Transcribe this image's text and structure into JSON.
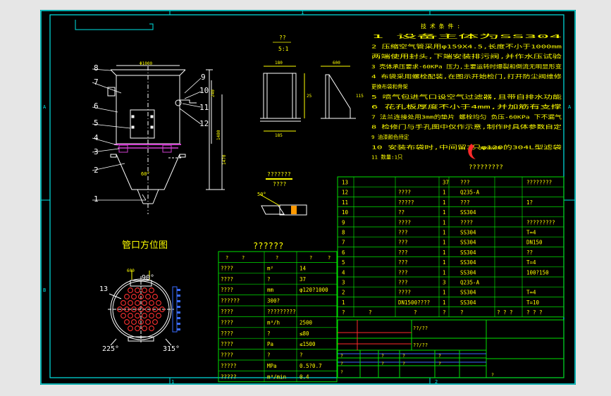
{
  "colors": {
    "frame": "#00e5e5",
    "table": "#00e000",
    "line": "#ffffff",
    "text": "#ffff00",
    "accent_red": "#ff2a2a",
    "accent_blue": "#3a6cff",
    "hatch": "#d040d0"
  },
  "zone_marks": {
    "top": "1",
    "bottom_left": "1",
    "bottom_right": "2",
    "left_a": "A",
    "left_b": "B",
    "right_a": "A"
  },
  "tech_req": {
    "title": "技 术 条 件 :",
    "items": [
      "1  设备主体为SS304",
      "2  压缩空气管采用φ159X4.5,长度不小于1000mm",
      "   两端使用封头,下端安装排污阀,并作水压试验",
      "3  壳体承压要求-60KPa  压力,主要运转时爆裂和倒流无明显形变",
      "4  布袋采用螺栓配装,在图示开始检门,打开防尘阀维修",
      "   更换布袋和骨架",
      "5  喷气包进气口设空气过滤器,且带自排水功能",
      "6  花孔板厚度不小于4mm,并加筋有支撑",
      "7  法兰连接处用3mm的垫片 螺栓均匀 负压-60KPa  下不漏气",
      "8  检修门与手孔图中仅作示意,制作时具体参数自定",
      "9  油漆颜色待定",
      "10 安装布袋时,中间留3只φ120的304L型滤袋",
      "11 数量:1只"
    ],
    "subtitle": "?????????"
  },
  "detail_a": {
    "title": "??",
    "scale": "5:1",
    "dims": [
      "180",
      "185",
      "25",
      "600",
      "115"
    ]
  },
  "detail_b": {
    "label": "???????",
    "sub": "????",
    "angle": "50°"
  },
  "main_view": {
    "callouts": [
      "1",
      "2",
      "3",
      "4",
      "5",
      "6",
      "7",
      "8",
      "9",
      "10",
      "11",
      "12"
    ],
    "dims": [
      "Φ1000",
      "60°",
      "240",
      "1480",
      "1470"
    ]
  },
  "orientation": {
    "title": "管口方位图",
    "label13": "13",
    "angle_left": "225°",
    "angle_right": "315°",
    "angle_top": "90°",
    "dim_top": "600"
  },
  "spec_table": {
    "title": "??????",
    "header": [
      "?",
      "?",
      "?",
      "?",
      "?"
    ],
    "rows": [
      [
        "????",
        "m²",
        "14"
      ],
      [
        "????",
        "?",
        "37"
      ],
      [
        "????",
        "mm",
        "φ120?1000"
      ],
      [
        "??????",
        "300?",
        ""
      ],
      [
        "????",
        "?????????",
        ""
      ],
      [
        "????",
        "m³/h",
        "2500"
      ],
      [
        "????",
        "?",
        "≤80"
      ],
      [
        "????",
        "Pa",
        "≤1500"
      ],
      [
        "????",
        "?",
        "?"
      ],
      [
        "?????",
        "MPa",
        "0.5?0.7"
      ],
      [
        "?????",
        "m³/min",
        "0.4"
      ]
    ]
  },
  "parts_list": {
    "rows": [
      {
        "no": "13",
        "name": "",
        "spec": "",
        "qty": "37",
        "mat": "???",
        "note": "????????"
      },
      {
        "no": "12",
        "name": "",
        "spec": "????",
        "qty": "1",
        "mat": "Q235-A",
        "note": ""
      },
      {
        "no": "11",
        "name": "",
        "spec": "?????",
        "qty": "1",
        "mat": "???",
        "note": "1?"
      },
      {
        "no": "10",
        "name": "",
        "spec": "??",
        "qty": "1",
        "mat": "SS304",
        "note": ""
      },
      {
        "no": "9",
        "name": "",
        "spec": "????",
        "qty": "1",
        "mat": "????",
        "note": "?????????"
      },
      {
        "no": "8",
        "name": "",
        "spec": "???",
        "qty": "1",
        "mat": "SS304",
        "note": "T=4"
      },
      {
        "no": "7",
        "name": "",
        "spec": "???",
        "qty": "1",
        "mat": "SS304",
        "note": "DN150"
      },
      {
        "no": "6",
        "name": "",
        "spec": "???",
        "qty": "1",
        "mat": "SS304",
        "note": "??"
      },
      {
        "no": "5",
        "name": "",
        "spec": "???",
        "qty": "1",
        "mat": "SS304",
        "note": "T=4"
      },
      {
        "no": "4",
        "name": "",
        "spec": "???",
        "qty": "1",
        "mat": "SS304",
        "note": "100?150"
      },
      {
        "no": "3",
        "name": "",
        "spec": "???",
        "qty": "3",
        "mat": "Q235-A",
        "note": ""
      },
      {
        "no": "2",
        "name": "",
        "spec": "????",
        "qty": "1",
        "mat": "SS304",
        "note": "T=4"
      },
      {
        "no": "1",
        "name": "",
        "spec": "DN1500????",
        "qty": "1",
        "mat": "SS304",
        "note": "T=10"
      }
    ],
    "header": [
      "?",
      "?",
      "?",
      "?",
      "?",
      "? ? ?",
      "? ? ?"
    ]
  },
  "title_block": {
    "cell_a": "??/??",
    "cell_b": "??/??",
    "marks": [
      "?",
      "?",
      "?",
      "?",
      "?",
      "?",
      "?",
      "?",
      "?",
      "?"
    ]
  }
}
